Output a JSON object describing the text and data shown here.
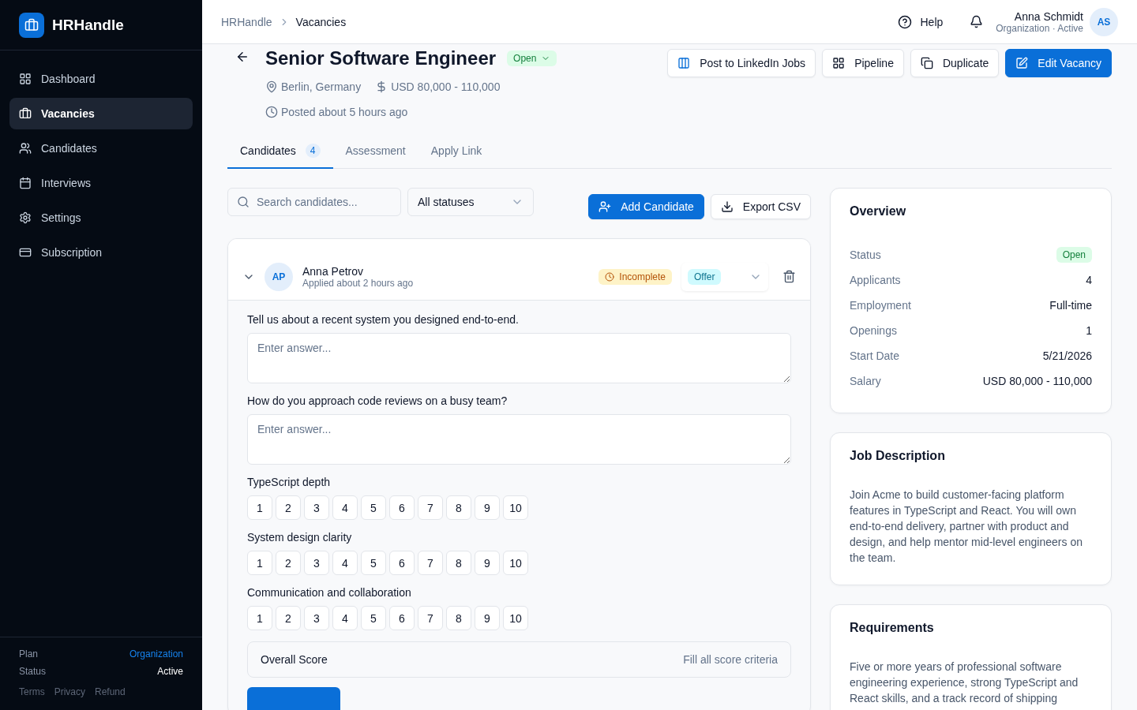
{
  "app": {
    "name": "HRHandle"
  },
  "sidebar": {
    "items": [
      {
        "label": "Dashboard",
        "selected": false
      },
      {
        "label": "Vacancies",
        "selected": true
      },
      {
        "label": "Candidates",
        "selected": false
      },
      {
        "label": "Interviews",
        "selected": false
      },
      {
        "label": "Settings",
        "selected": false
      },
      {
        "label": "Subscription",
        "selected": false
      }
    ],
    "plan": [
      {
        "label": "Plan",
        "value": "Organization",
        "kind": "link"
      },
      {
        "label": "Status",
        "value": "Active",
        "kind": "text"
      }
    ],
    "footer_links": [
      "Terms",
      "Privacy",
      "Refund"
    ]
  },
  "topbar": {
    "breadcrumbs": [
      "HRHandle",
      "Vacancies"
    ],
    "help": "Help",
    "user": {
      "name": "Anna Schmidt",
      "subtitle": "Organization · Active",
      "initials": "AS"
    }
  },
  "vacancy": {
    "title": "Senior Software Engineer",
    "status": "Open",
    "location": "Berlin, Germany",
    "salary": "USD 80,000 - 110,000",
    "posted": "Posted about 5 hours ago",
    "actions": [
      {
        "label": "Post to LinkedIn Jobs",
        "kind": "outline"
      },
      {
        "label": "Pipeline",
        "kind": "outline"
      },
      {
        "label": "Duplicate",
        "kind": "outline"
      },
      {
        "label": "Edit Vacancy",
        "kind": "primary"
      }
    ]
  },
  "tabs": [
    {
      "label": "Candidates",
      "count": "4",
      "selected": true
    },
    {
      "label": "Assessment",
      "selected": false
    },
    {
      "label": "Apply Link",
      "selected": false
    }
  ],
  "toolbar": {
    "search": {
      "placeholder": "Search candidates..."
    },
    "status_filter": "All statuses",
    "add": "Add Candidate",
    "export": "Export CSV"
  },
  "candidate": {
    "initials": "AP",
    "name": "Anna Petrov",
    "applied": "Applied about 2 hours ago",
    "assessment": "Incomplete",
    "stage": "Offer",
    "expanded": true,
    "questions": [
      {
        "label": "Tell us about a recent system you designed end-to-end.",
        "placeholder": "Enter answer..."
      },
      {
        "label": "How do you approach code reviews on a busy team?",
        "placeholder": "Enter answer..."
      }
    ],
    "criteria": [
      {
        "label": "TypeScript depth",
        "options": [
          "1",
          "2",
          "3",
          "4",
          "5",
          "6",
          "7",
          "8",
          "9",
          "10"
        ]
      },
      {
        "label": "System design clarity",
        "options": [
          "1",
          "2",
          "3",
          "4",
          "5",
          "6",
          "7",
          "8",
          "9",
          "10"
        ]
      },
      {
        "label": "Communication and collaboration",
        "options": [
          "1",
          "2",
          "3",
          "4",
          "5",
          "6",
          "7",
          "8",
          "9",
          "10"
        ]
      }
    ],
    "overall": {
      "label": "Overall Score",
      "hint": "Fill all score criteria"
    }
  },
  "overview": {
    "title": "Overview",
    "rows": [
      {
        "label": "Status",
        "value": "Open",
        "kind": "badge"
      },
      {
        "label": "Applicants",
        "value": "4",
        "kind": "text"
      },
      {
        "label": "Employment",
        "value": "Full-time",
        "kind": "text"
      },
      {
        "label": "Openings",
        "value": "1",
        "kind": "text"
      },
      {
        "label": "Start Date",
        "value": "5/21/2026",
        "kind": "text"
      },
      {
        "label": "Salary",
        "value": "USD 80,000 - 110,000",
        "kind": "text"
      }
    ]
  },
  "job_description": {
    "title": "Job Description",
    "text": "Join Acme to build customer-facing platform features in TypeScript and React. You will own end-to-end delivery, partner with product and design, and help mentor mid-level engineers on the team."
  },
  "requirements": {
    "title": "Requirements",
    "text": "Five or more years of professional software engineering experience, strong TypeScript and React skills, and a track record of shipping"
  }
}
